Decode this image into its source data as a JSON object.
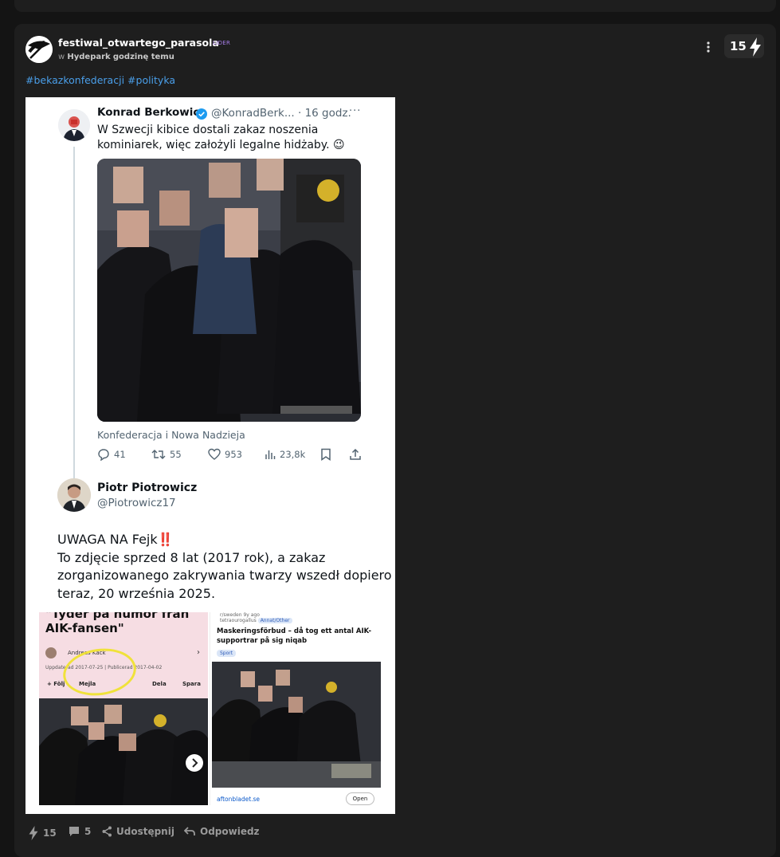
{
  "post": {
    "author": "festiwal_otwartego_parasola",
    "badge": "LIDER",
    "meta_prefix": "w",
    "community": "Hydepark",
    "time": "godzinę temu",
    "score": "15",
    "tags": [
      "#bekazkonfederacji",
      "#polityka"
    ]
  },
  "image": {
    "tweet1": {
      "name": "Konrad Berkowicz",
      "handle": "@KonradBerk... · 16 godz.",
      "text": "W Szwecji kibice dostali zakaz noszenia kominiarek, więc założyli legalne hidżaby. 😉",
      "caption": "Konfederacja i Nowa Nadzieja",
      "replies": "41",
      "retweets": "55",
      "likes": "953",
      "views": "23,8k"
    },
    "tweet2": {
      "name": "Piotr Piotrowicz",
      "handle": "@Piotrowicz17",
      "line1": "UWAGA NA Fejk",
      "bang": "‼️",
      "line2": "To zdjęcie sprzed 8 lat (2017 rok), a zakaz zorganizowanego zakrywania twarzy wszedł dopiero teraz, 20 września 2025."
    },
    "left_panel": {
      "title": "\"Tyder på humor från AIK-fansen\"",
      "author": "Andreas Käck",
      "dates": "Uppdaterad 2017-07-25 | Publicerad 2017-04-02",
      "follow": "+ Följ",
      "mail": "Mejla",
      "share": "Dela",
      "save": "Spara"
    },
    "right_panel": {
      "sub": "r/sweden",
      "age": "9y ago",
      "user": "tetraourogallus",
      "flair": "Annat/Other",
      "title": "Maskeringsförbud – då tog ett antal AIK-supportrar på sig niqab",
      "tag": "Sport",
      "link": "aftonbladet.se",
      "open": "Open"
    }
  },
  "footer": {
    "score": "15",
    "comments": "5",
    "share": "Udostępnij",
    "reply": "Odpowiedz"
  },
  "colors": {
    "background": "#141414",
    "card": "#1e1e1e",
    "tag": "#4a9fea",
    "badge": "#a77de8",
    "twitter_blue": "#1d9bf0"
  }
}
